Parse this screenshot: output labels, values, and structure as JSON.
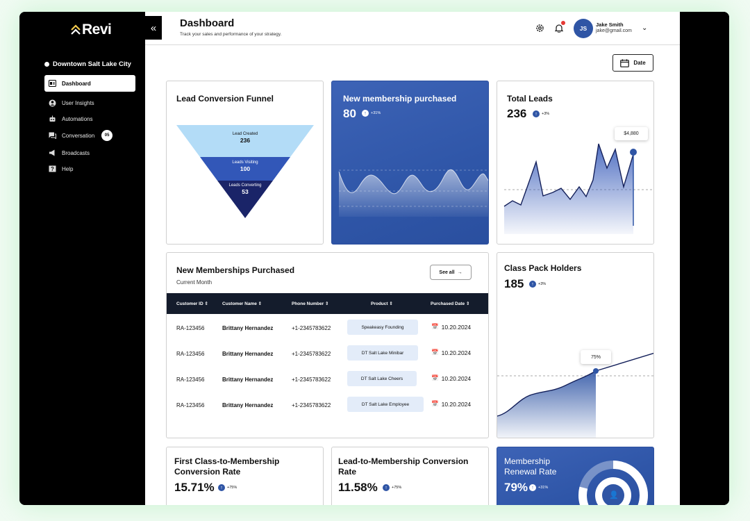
{
  "app": {
    "logo_text": "Revi",
    "collapse_icon": "«"
  },
  "sidebar": {
    "location": "Downtown Salt Lake City",
    "items": [
      {
        "label": "Dashboard",
        "icon": "dashboard-icon",
        "active": true
      },
      {
        "label": "User Insights",
        "icon": "user-insights-icon"
      },
      {
        "label": "Automations",
        "icon": "robot-icon"
      },
      {
        "label": "Conversation",
        "icon": "chat-icon",
        "badge": "05"
      },
      {
        "label": "Broadcasts",
        "icon": "megaphone-icon"
      },
      {
        "label": "Help",
        "icon": "help-icon"
      }
    ]
  },
  "header": {
    "title": "Dashboard",
    "subtitle": "Track your sales and performance of your strategy.",
    "user": {
      "initials": "JS",
      "name": "Jake Smith",
      "email": "jake@gmail.com"
    }
  },
  "date_button": "Date",
  "funnel": {
    "title": "Lead Conversion Funnel",
    "stages": [
      {
        "label": "Lead Created",
        "value": "236"
      },
      {
        "label": "Leads Visiting",
        "value": "100"
      },
      {
        "label": "Leads Converting",
        "value": "53"
      }
    ]
  },
  "membership_card": {
    "title": "New membership purchased",
    "value": "80",
    "trend": "+31%"
  },
  "total_leads": {
    "title": "Total Leads",
    "value": "236",
    "trend": "+3%",
    "tooltip": "$4,880"
  },
  "memberships_table": {
    "title": "New Memberships Purchased",
    "subtitle": "Current Month",
    "see_all": "See all",
    "columns": [
      "Customer ID",
      "Customer Name",
      "Phone Number",
      "Product",
      "Purchased Date"
    ],
    "rows": [
      {
        "id": "RA-123456",
        "name": "Brittany Hernandez",
        "phone": "+1-2345783622",
        "product": "Speakeasy Founding",
        "date": "10.20.2024"
      },
      {
        "id": "RA-123456",
        "name": "Brittany Hernandez",
        "phone": "+1-2345783622",
        "product": "DT Salt Lake Minibar",
        "date": "10.20.2024"
      },
      {
        "id": "RA-123456",
        "name": "Brittany Hernandez",
        "phone": "+1-2345783622",
        "product": "DT Salt Lake Cheers",
        "date": "10.20.2024"
      },
      {
        "id": "RA-123456",
        "name": "Brittany Hernandez",
        "phone": "+1-2345783622",
        "product": "DT Salt Lake Employee",
        "date": "10.20.2024"
      }
    ]
  },
  "class_pack": {
    "title": "Class Pack Holders",
    "value": "185",
    "trend": "+3%",
    "tooltip": "75%"
  },
  "first_class": {
    "title_line1": "First Class-to-Membership",
    "title_line2": "Conversion Rate",
    "value": "15.71%",
    "trend": "+75%"
  },
  "lead_to_membership": {
    "title_line1": "Lead-to-Membership Conversion",
    "title_line2": "Rate",
    "value": "11.58%",
    "trend": "+75%"
  },
  "renewal": {
    "title_line1": "Membership",
    "title_line2": "Renewal Rate",
    "value": "79%",
    "trend": "+31%"
  },
  "colors": {
    "accent": "#2f55a5",
    "dark": "#141c2c",
    "funnel_top": "#b3dcf7",
    "funnel_mid": "#3257b8",
    "funnel_bottom": "#1a2468"
  }
}
